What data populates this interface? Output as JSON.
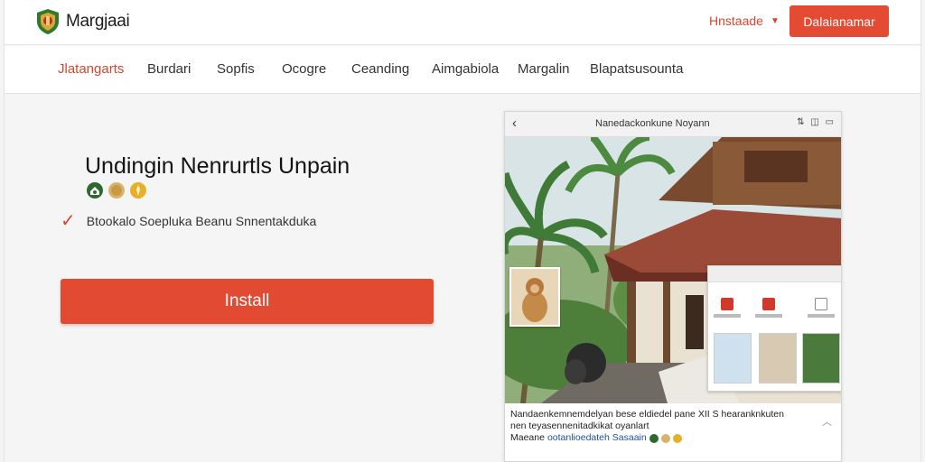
{
  "brand": {
    "name": "Margjaai",
    "logo_icon": "shield-logo-icon"
  },
  "header": {
    "language": "Hnstaade",
    "cta_label": "Dalaianamar"
  },
  "nav": {
    "items": [
      {
        "label": "Jlatangarts",
        "active": true
      },
      {
        "label": "Burdari",
        "active": false
      },
      {
        "label": "Sopfis",
        "active": false
      },
      {
        "label": "Ocogre",
        "active": false
      },
      {
        "label": "Ceanding",
        "active": false
      },
      {
        "label": "Aimgabiola",
        "active": false
      },
      {
        "label": "Margalin",
        "active": false
      },
      {
        "label": "Blapatsusounta",
        "active": false
      }
    ]
  },
  "hero": {
    "title": "Undingin Nenrurtls Unpain",
    "feature_text": "Btookalo Soepluka Beanu Snnentakduka",
    "install_label": "Install",
    "badges": [
      "home-badge-icon",
      "coin-badge-icon",
      "medal-badge-icon"
    ]
  },
  "phone": {
    "title": "Nanedackonkune Noyann",
    "status": "⇅ ◫ ▭",
    "caption_line1": "Nandaenkemnemdelyan bese eldiedel pane XII S hearanknkuten",
    "caption_line2": "nen teyasennenitadkikat oyanlart",
    "caption_line3_prefix": "Maeane",
    "caption_line3_name": "ootanlioedateh Sasaain"
  },
  "colors": {
    "accent": "#e34b33",
    "nav_active": "#d6452f"
  }
}
